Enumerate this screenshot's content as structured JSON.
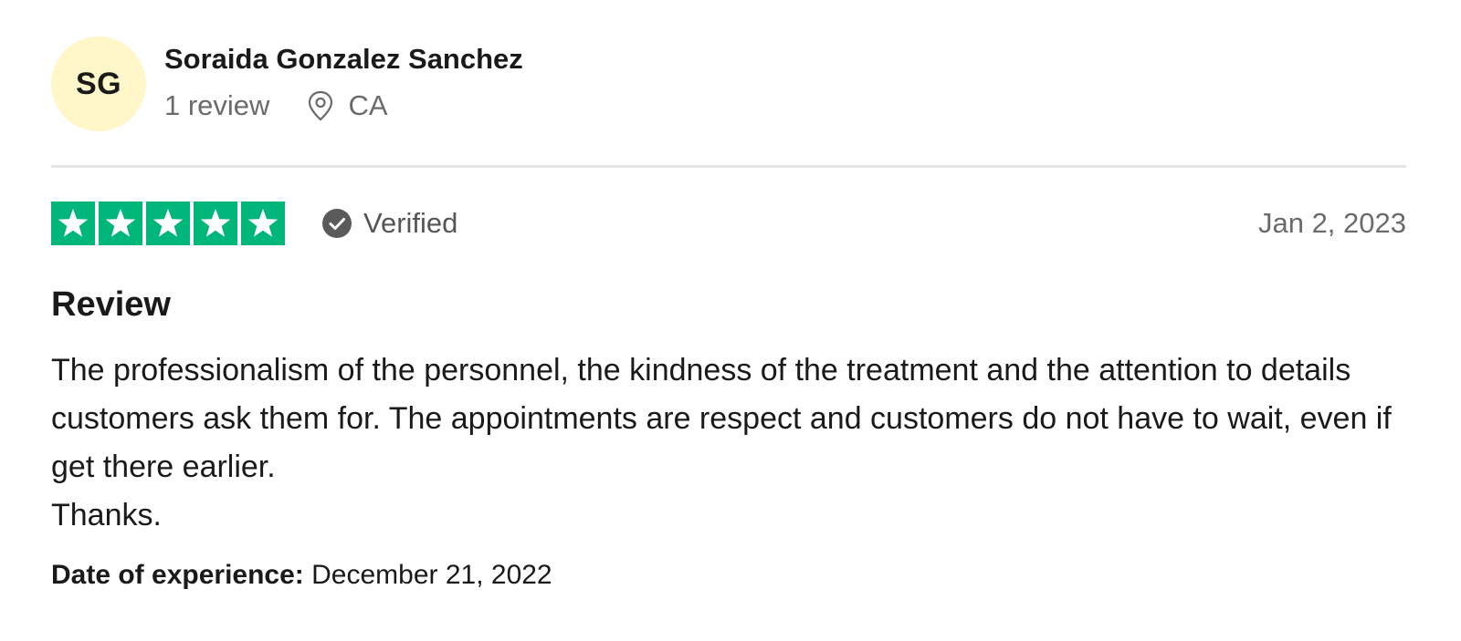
{
  "user": {
    "initials": "SG",
    "avatar_color": "#fff6c9",
    "name": "Soraida Gonzalez Sanchez",
    "review_count": "1 review",
    "location": "CA",
    "location_icon": "map-pin-icon"
  },
  "rating": {
    "stars": 5,
    "max_stars": 5,
    "star_color": "#00b67a",
    "verified_icon": "check-circle-icon",
    "verified_label": "Verified",
    "date": "Jan 2, 2023"
  },
  "review": {
    "title": "Review",
    "body_paragraph_1": "The professionalism of the personnel, the kindness of the treatment and the attention to details customers ask them for. The appointments are respect and customers do not have to wait, even if get there earlier.",
    "body_paragraph_2": "Thanks."
  },
  "experience": {
    "label": "Date of experience:",
    "date": "December 21, 2022"
  }
}
